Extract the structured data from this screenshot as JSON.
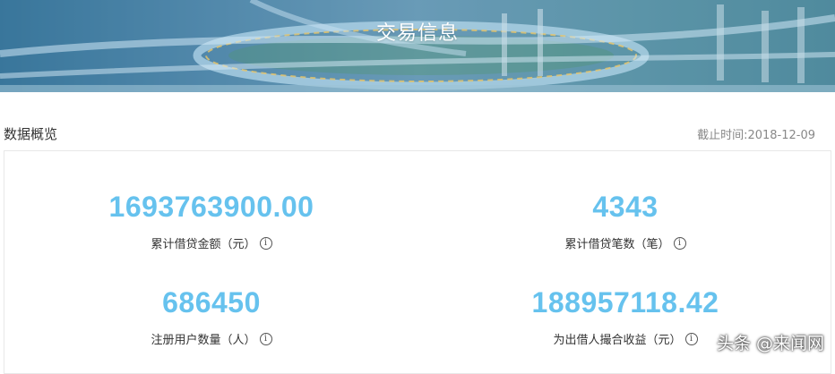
{
  "banner": {
    "title": "交易信息"
  },
  "overview": {
    "title": "数据概览",
    "cutoff": "截止时间:2018-12-09"
  },
  "stats": [
    {
      "value": "1693763900.00",
      "label": "累计借贷金额（元）"
    },
    {
      "value": "4343",
      "label": "累计借贷笔数（笔）"
    },
    {
      "value": "686450",
      "label": "注册用户数量（人）"
    },
    {
      "value": "188957118.42",
      "label": "为出借人撮合收益（元）"
    }
  ],
  "info_icon": "info-icon",
  "watermark": "头条 @来闻网",
  "colors": {
    "accent": "#66c2ee",
    "banner": "#6fa6c4"
  }
}
